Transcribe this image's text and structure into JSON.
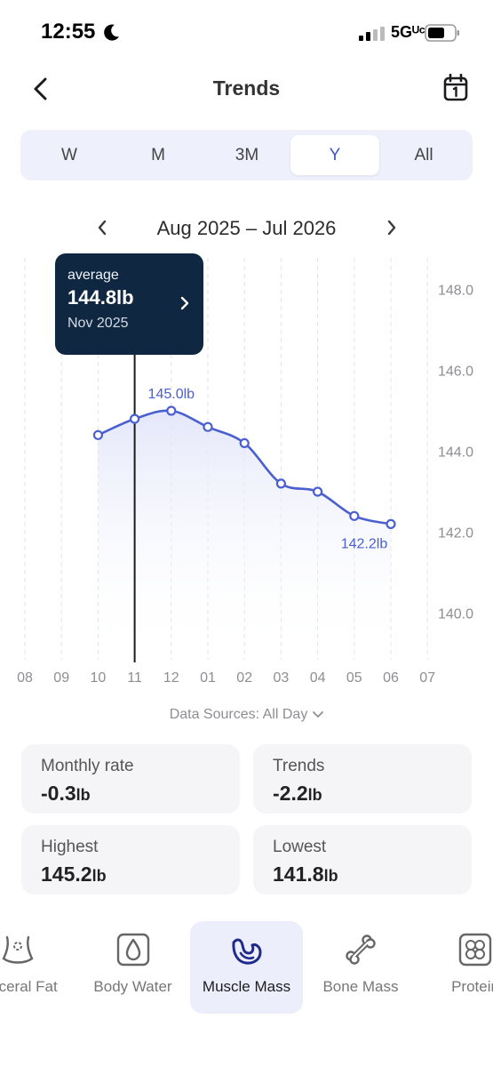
{
  "status_bar": {
    "time": "12:55",
    "network": "5Gᵁᶜ"
  },
  "header": {
    "title": "Trends"
  },
  "period_tabs": [
    {
      "label": "W",
      "active": false
    },
    {
      "label": "M",
      "active": false
    },
    {
      "label": "3M",
      "active": false
    },
    {
      "label": "Y",
      "active": true
    },
    {
      "label": "All",
      "active": false
    }
  ],
  "range": {
    "label": "Aug 2025 – Jul 2026"
  },
  "tooltip": {
    "kind": "average",
    "value": "144.8lb",
    "date": "Nov 2025"
  },
  "chart_data": {
    "type": "line",
    "x": [
      "08",
      "09",
      "10",
      "11",
      "12",
      "01",
      "02",
      "03",
      "04",
      "05",
      "06",
      "07"
    ],
    "series": [
      {
        "values": [
          null,
          null,
          144.4,
          144.8,
          145.0,
          144.6,
          144.2,
          143.2,
          143.0,
          142.4,
          142.2,
          null
        ]
      }
    ],
    "ylim": [
      139,
      149
    ],
    "yticks": [
      "140.0",
      "142.0",
      "144.0",
      "146.0",
      "148.0"
    ],
    "annotations": [
      {
        "label": "145.0lb",
        "index": 4
      },
      {
        "label": "142.2lb",
        "index": 10
      }
    ],
    "selected_index": 3,
    "color": "#4a5fd0",
    "grid": true
  },
  "data_sources": "Data Sources: All Day",
  "stats": [
    {
      "label": "Monthly rate",
      "value": "-0.3",
      "unit": "lb"
    },
    {
      "label": "Trends",
      "value": "-2.2",
      "unit": "lb"
    },
    {
      "label": "Highest",
      "value": "145.2",
      "unit": "lb"
    },
    {
      "label": "Lowest",
      "value": "141.8",
      "unit": "lb"
    }
  ],
  "metric_nav": [
    {
      "label": "Visceral Fat",
      "icon": "visceral-fat-icon",
      "active": false
    },
    {
      "label": "Body Water",
      "icon": "body-water-icon",
      "active": false
    },
    {
      "label": "Muscle Mass",
      "icon": "muscle-mass-icon",
      "active": true
    },
    {
      "label": "Bone Mass",
      "icon": "bone-mass-icon",
      "active": false
    },
    {
      "label": "Protein",
      "icon": "protein-icon",
      "active": false
    }
  ]
}
